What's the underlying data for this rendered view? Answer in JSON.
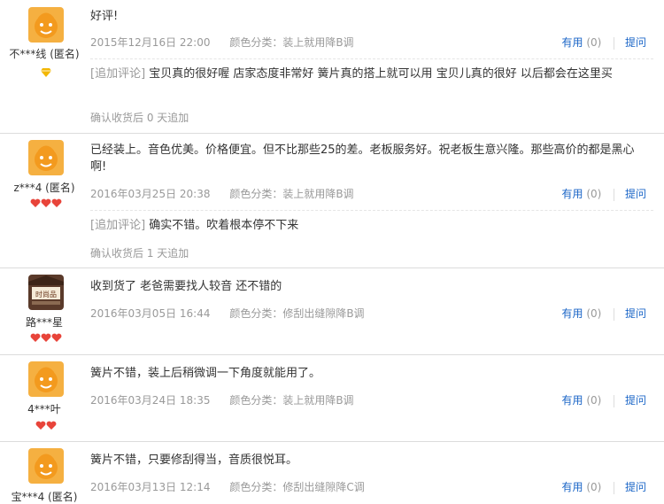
{
  "reviews": [
    {
      "nick": "不***线 (匿名)",
      "content": "好评!",
      "date": "2015年12月16日 22:00",
      "color_category": "颜色分类：装上就用降B调",
      "useful_label": "有用",
      "useful_count": "(0)",
      "ask_label": "提问",
      "append_tag": "[追加评论]",
      "append_text": "宝贝真的很好喔 店家态度非常好 簧片真的搭上就可以用 宝贝儿真的很好 以后都会在这里买",
      "confirm": "确认收货后 0 天追加",
      "badge": "diamond"
    },
    {
      "nick": "z***4 (匿名)",
      "content": "已经装上。音色优美。价格便宜。但不比那些25的差。老板服务好。祝老板生意兴隆。那些高价的都是黑心啊!",
      "date": "2016年03月25日 20:38",
      "color_category": "颜色分类：装上就用降B调",
      "useful_label": "有用",
      "useful_count": "(0)",
      "ask_label": "提问",
      "append_tag": "[追加评论]",
      "append_text": "确实不错。吹着根本停不下来",
      "confirm": "确认收货后 1 天追加",
      "badge": "hearts-3"
    },
    {
      "nick": "路***星",
      "content": "收到货了 老爸需要找人较音 还不错的",
      "date": "2016年03月05日 16:44",
      "color_category": "颜色分类：修刮出缝隙降B调",
      "useful_label": "有用",
      "useful_count": "(0)",
      "ask_label": "提问",
      "badge": "hearts-3"
    },
    {
      "nick": "4***叶",
      "content": "簧片不错，装上后稍微调一下角度就能用了。",
      "date": "2016年03月24日 18:35",
      "color_category": "颜色分类：装上就用降B调",
      "useful_label": "有用",
      "useful_count": "(0)",
      "ask_label": "提问",
      "badge": "hearts-2"
    },
    {
      "nick": "宝***4 (匿名)",
      "content": "簧片不错，只要修刮得当，音质很悦耳。",
      "date": "2016年03月13日 12:14",
      "color_category": "颜色分类：修刮出缝隙降C调",
      "useful_label": "有用",
      "useful_count": "(0)",
      "ask_label": "提问",
      "badge": "none"
    }
  ],
  "colors": {
    "link_blue": "#1b66c7",
    "meta_gray": "#999999",
    "avatar_orange": "#f39a1e",
    "heart_red": "#e8443a",
    "diamond_gold": "#f2b705"
  },
  "avatar_store_text": "时尚品"
}
